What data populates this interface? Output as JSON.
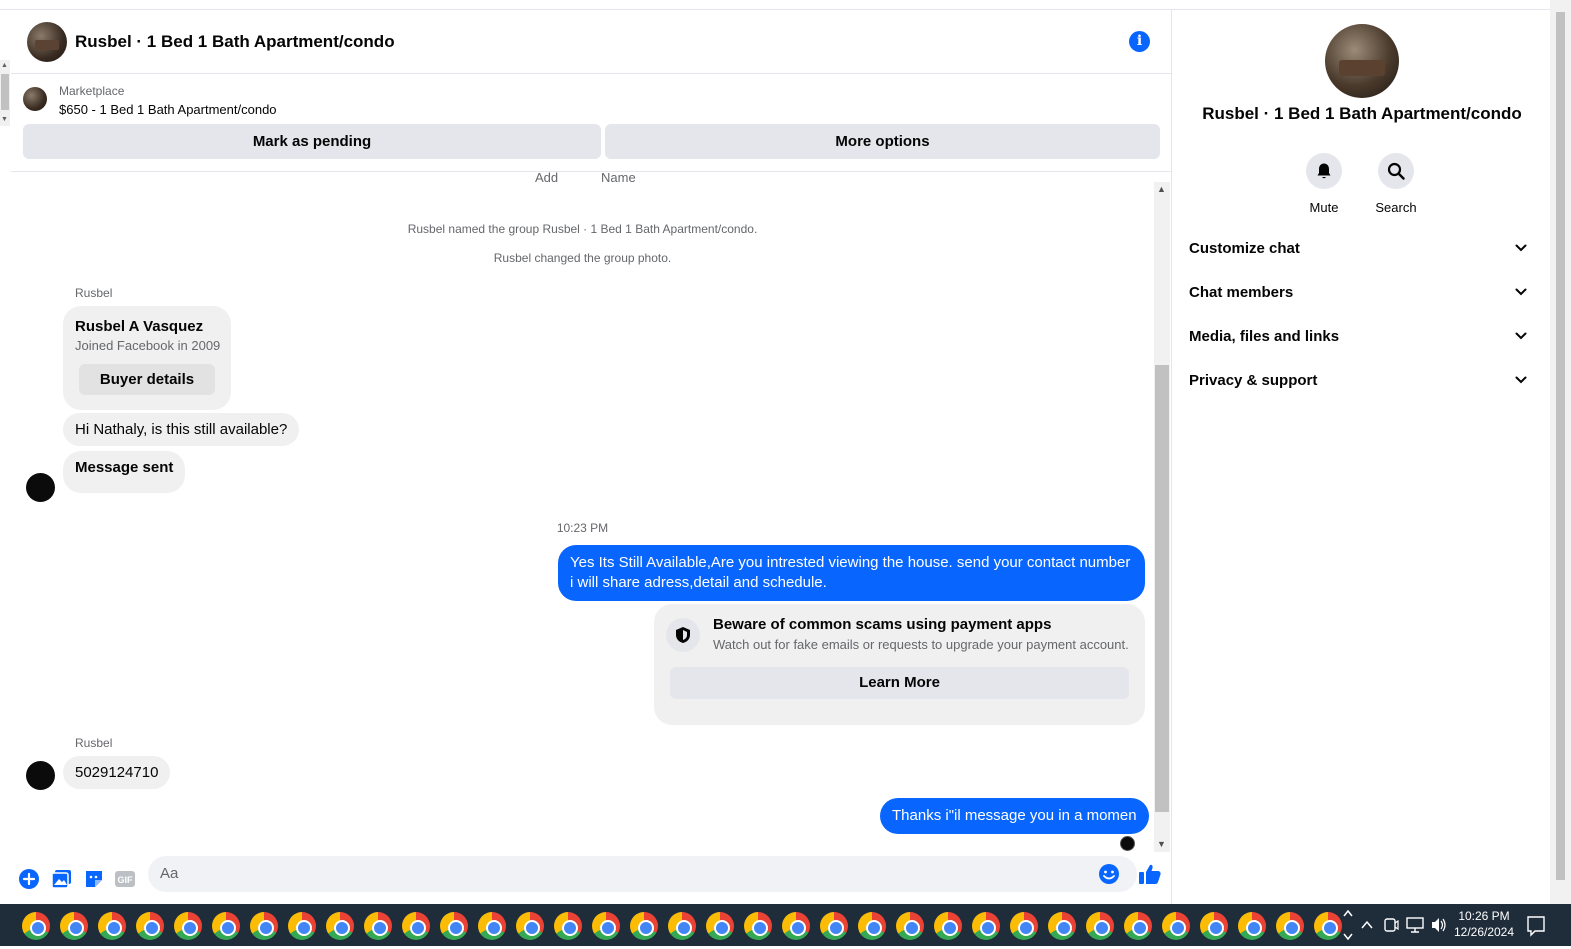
{
  "header": {
    "title": "Rusbel · 1 Bed 1 Bath Apartment/condo"
  },
  "marketplace": {
    "label": "Marketplace",
    "listing": "$650 - 1 Bed 1 Bath Apartment/condo",
    "pending_button": "Mark as pending",
    "more_button": "More options"
  },
  "thread": {
    "partial_labels": [
      "Add",
      "Name"
    ],
    "system_messages": [
      "Rusbel named the group Rusbel · 1 Bed 1 Bath Apartment/condo.",
      "Rusbel changed the group photo."
    ],
    "sender_name": "Rusbel",
    "buyer_card": {
      "name": "Rusbel A Vasquez",
      "joined": "Joined Facebook in 2009",
      "button": "Buyer details"
    },
    "incoming_1": "Hi Nathaly, is this still available?",
    "incoming_2": "Message sent",
    "timestamp": "10:23 PM",
    "outgoing_1": "Yes Its Still Available,Are you intrested viewing the house. send your contact number i will share adress,detail and schedule.",
    "warning": {
      "title": "Beware of common scams using payment apps",
      "subtitle": "Watch out for fake emails or requests to upgrade your payment account.",
      "button": "Learn More"
    },
    "sender_name_2": "Rusbel",
    "incoming_3": "5029124710",
    "outgoing_2": "Thanks i\"il message you in a momen"
  },
  "composer": {
    "placeholder": "Aa",
    "gif_label": "GIF"
  },
  "panel": {
    "title": "Rusbel · 1 Bed 1 Bath Apartment/condo",
    "mute_label": "Mute",
    "search_label": "Search",
    "sections": [
      "Customize chat",
      "Chat members",
      "Media, files and links",
      "Privacy & support"
    ]
  },
  "taskbar": {
    "time": "10:26 PM",
    "date": "12/26/2024"
  },
  "colors": {
    "accent": "#0866ff",
    "bubble_in": "#f0f0f0",
    "taskbar": "#1f2c3a"
  }
}
